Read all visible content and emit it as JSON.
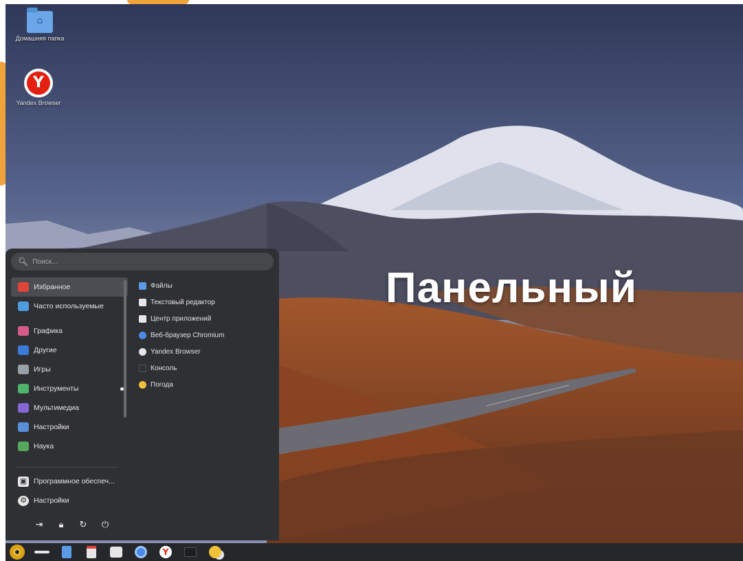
{
  "desktop": {
    "icons": [
      {
        "label": "Домашняя папка",
        "icon": "home-folder-icon"
      },
      {
        "label": "Yandex Browser",
        "icon": "yandex-browser-icon"
      }
    ],
    "overlay_title": "Панельный"
  },
  "menu": {
    "search_placeholder": "Поиск...",
    "categories": [
      {
        "label": "Избранное",
        "icon": "heart-icon",
        "color": "#e0453a"
      },
      {
        "label": "Часто используемые",
        "icon": "folder-icon",
        "color": "#4f9be0"
      },
      {
        "label": "Графика",
        "icon": "graphics-icon",
        "color": "#d55b8a"
      },
      {
        "label": "Другие",
        "icon": "apps-icon",
        "color": "#3b7ad9"
      },
      {
        "label": "Игры",
        "icon": "gamepad-icon",
        "color": "#9aa0a8"
      },
      {
        "label": "Инструменты",
        "icon": "tools-icon",
        "color": "#4fb36d"
      },
      {
        "label": "Мультимедиа",
        "icon": "multimedia-icon",
        "color": "#8466d4"
      },
      {
        "label": "Настройки",
        "icon": "settings-icon",
        "color": "#5a8ed8"
      },
      {
        "label": "Наука",
        "icon": "science-icon",
        "color": "#57a85c"
      }
    ],
    "apps": [
      {
        "label": "Файлы",
        "icon": "files-icon",
        "color": "#5a9be6"
      },
      {
        "label": "Текстовый редактор",
        "icon": "text-editor-icon",
        "color": "#e6e6e6"
      },
      {
        "label": "Центр приложений",
        "icon": "app-center-icon",
        "color": "#e6e6e6"
      },
      {
        "label": "Веб-браузер Chromium",
        "icon": "chromium-icon",
        "color": "#4a8be8"
      },
      {
        "label": "Yandex Browser",
        "icon": "yandex-browser-icon",
        "color": "#e6e6e6"
      },
      {
        "label": "Консоль",
        "icon": "terminal-icon",
        "color": "#2f3033"
      },
      {
        "label": "Погода",
        "icon": "weather-icon",
        "color": "#f2c23a"
      }
    ],
    "bottom": [
      {
        "label": "Программное обеспеч...",
        "icon": "software-store-icon"
      },
      {
        "label": "Настройки",
        "icon": "gear-icon"
      }
    ],
    "session_buttons": [
      "logout-icon",
      "lock-icon",
      "restart-icon",
      "power-icon"
    ]
  },
  "taskbar": {
    "items": [
      "start-menu-icon",
      "window-list-icon",
      "files-icon",
      "text-editor-icon",
      "app-center-icon",
      "chromium-icon",
      "yandex-browser-icon",
      "terminal-icon",
      "weather-icon"
    ]
  }
}
